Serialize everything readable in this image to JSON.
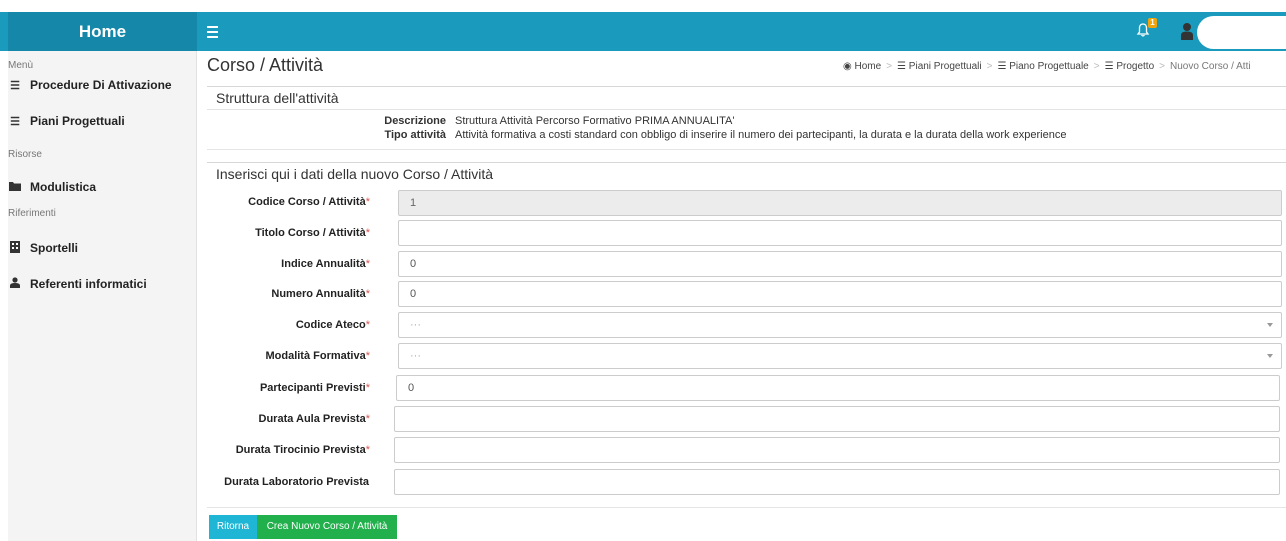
{
  "topbar": {
    "brand": "Home",
    "notification_count": "1"
  },
  "sidebar": {
    "sections": [
      {
        "label": "Menù"
      },
      {
        "label": "Risorse"
      },
      {
        "label": "Riferimenti"
      }
    ],
    "items": [
      {
        "label": "Procedure Di Attivazione",
        "icon": "list-icon"
      },
      {
        "label": "Piani Progettuali",
        "icon": "list-icon"
      },
      {
        "label": "Modulistica",
        "icon": "folder-icon"
      },
      {
        "label": "Sportelli",
        "icon": "building-icon"
      },
      {
        "label": "Referenti informatici",
        "icon": "user-icon"
      }
    ]
  },
  "page": {
    "title": "Corso / Attività"
  },
  "breadcrumb": [
    {
      "label": "Home",
      "icon": "dashboard-icon"
    },
    {
      "label": "Piani Progettuali",
      "icon": "list-icon"
    },
    {
      "label": "Piano Progettuale",
      "icon": "list-icon"
    },
    {
      "label": "Progetto",
      "icon": "list-icon"
    },
    {
      "label": "Nuovo Corso / Atti"
    }
  ],
  "structure_panel": {
    "title": "Struttura dell'attività",
    "rows": [
      {
        "label": "Descrizione",
        "value": "Struttura Attività Percorso Formativo PRIMA ANNUALITA'"
      },
      {
        "label": "Tipo attività",
        "value": "Attività formativa a costi standard con obbligo di inserire il numero dei partecipanti, la durata e la durata della work experience"
      }
    ]
  },
  "form_panel": {
    "title": "Inserisci qui i dati della nuovo Corso / Attività",
    "fields": [
      {
        "label": "Codice Corso / Attività",
        "required": "*",
        "value": "1",
        "type": "disabled"
      },
      {
        "label": "Titolo Corso / Attività",
        "required": "*",
        "value": "",
        "type": "text"
      },
      {
        "label": "Indice Annualità",
        "required": "*",
        "value": "0",
        "type": "text"
      },
      {
        "label": "Numero Annualità",
        "required": "*",
        "value": "0",
        "type": "text"
      },
      {
        "label": "Codice Ateco",
        "required": "*",
        "value": "···",
        "type": "select"
      },
      {
        "label": "Modalità Formativa",
        "required": "*",
        "value": "···",
        "type": "select"
      },
      {
        "label": "Partecipanti Previsti",
        "required": "*",
        "value": "0",
        "type": "text"
      },
      {
        "label": "Durata Aula Prevista",
        "required": "*",
        "value": "",
        "type": "text"
      },
      {
        "label": "Durata Tirocinio Prevista",
        "required": "*",
        "value": "",
        "type": "text"
      },
      {
        "label": "Durata Laboratorio Prevista",
        "required": "",
        "value": "",
        "type": "text"
      }
    ]
  },
  "actions": {
    "back_label": "Ritorna",
    "create_label": "Crea Nuovo Corso / Attività"
  },
  "colors": {
    "topbar": "#1a9bbd",
    "brand": "#1587a8",
    "back_button": "#1fb6d5",
    "create_button": "#21b04b",
    "required": "#d9534f"
  }
}
